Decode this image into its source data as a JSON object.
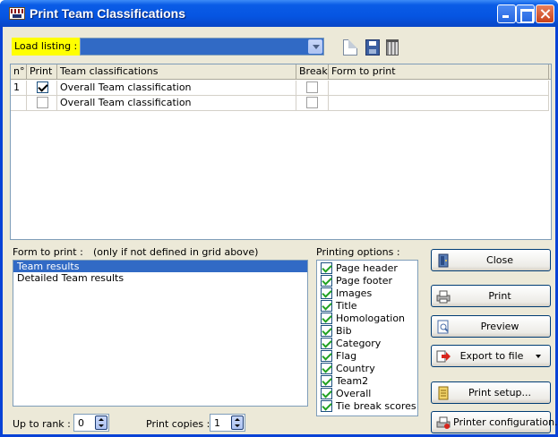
{
  "window": {
    "title": "Print Team Classifications"
  },
  "toolbar": {
    "load_listing_label": "Load listing :",
    "load_listing_value": ""
  },
  "grid": {
    "columns": [
      "n°",
      "Print",
      "Team classifications",
      "Break",
      "Form to print"
    ],
    "rows": [
      {
        "n": "1",
        "print": true,
        "classification": "Overall Team classification",
        "break": false,
        "form": ""
      },
      {
        "n": "",
        "print": false,
        "classification": "Overall Team classification",
        "break": false,
        "form": ""
      }
    ]
  },
  "form_to_print": {
    "label": "Form to print :",
    "note": "(only if not defined in grid above)",
    "items": [
      "Team results",
      "Detailed Team results"
    ],
    "selected_index": 0
  },
  "printing_options": {
    "label": "Printing options :",
    "items": [
      {
        "label": "Page header",
        "checked": true
      },
      {
        "label": "Page footer",
        "checked": true
      },
      {
        "label": "Images",
        "checked": true
      },
      {
        "label": "Title",
        "checked": true
      },
      {
        "label": "Homologation",
        "checked": true
      },
      {
        "label": "Bib",
        "checked": true
      },
      {
        "label": "Category",
        "checked": true
      },
      {
        "label": "Flag",
        "checked": true
      },
      {
        "label": "Country",
        "checked": true
      },
      {
        "label": "Team2",
        "checked": true
      },
      {
        "label": "Overall",
        "checked": true
      },
      {
        "label": "Tie break scores",
        "checked": true
      }
    ]
  },
  "buttons": {
    "close": "Close",
    "print": "Print",
    "preview": "Preview",
    "export": "Export to file",
    "print_setup": "Print setup...",
    "printer_config": "Printer configuration..."
  },
  "footer": {
    "up_to_rank_label": "Up to rank :",
    "up_to_rank_value": "0",
    "print_copies_label": "Print copies :",
    "print_copies_value": "1"
  }
}
